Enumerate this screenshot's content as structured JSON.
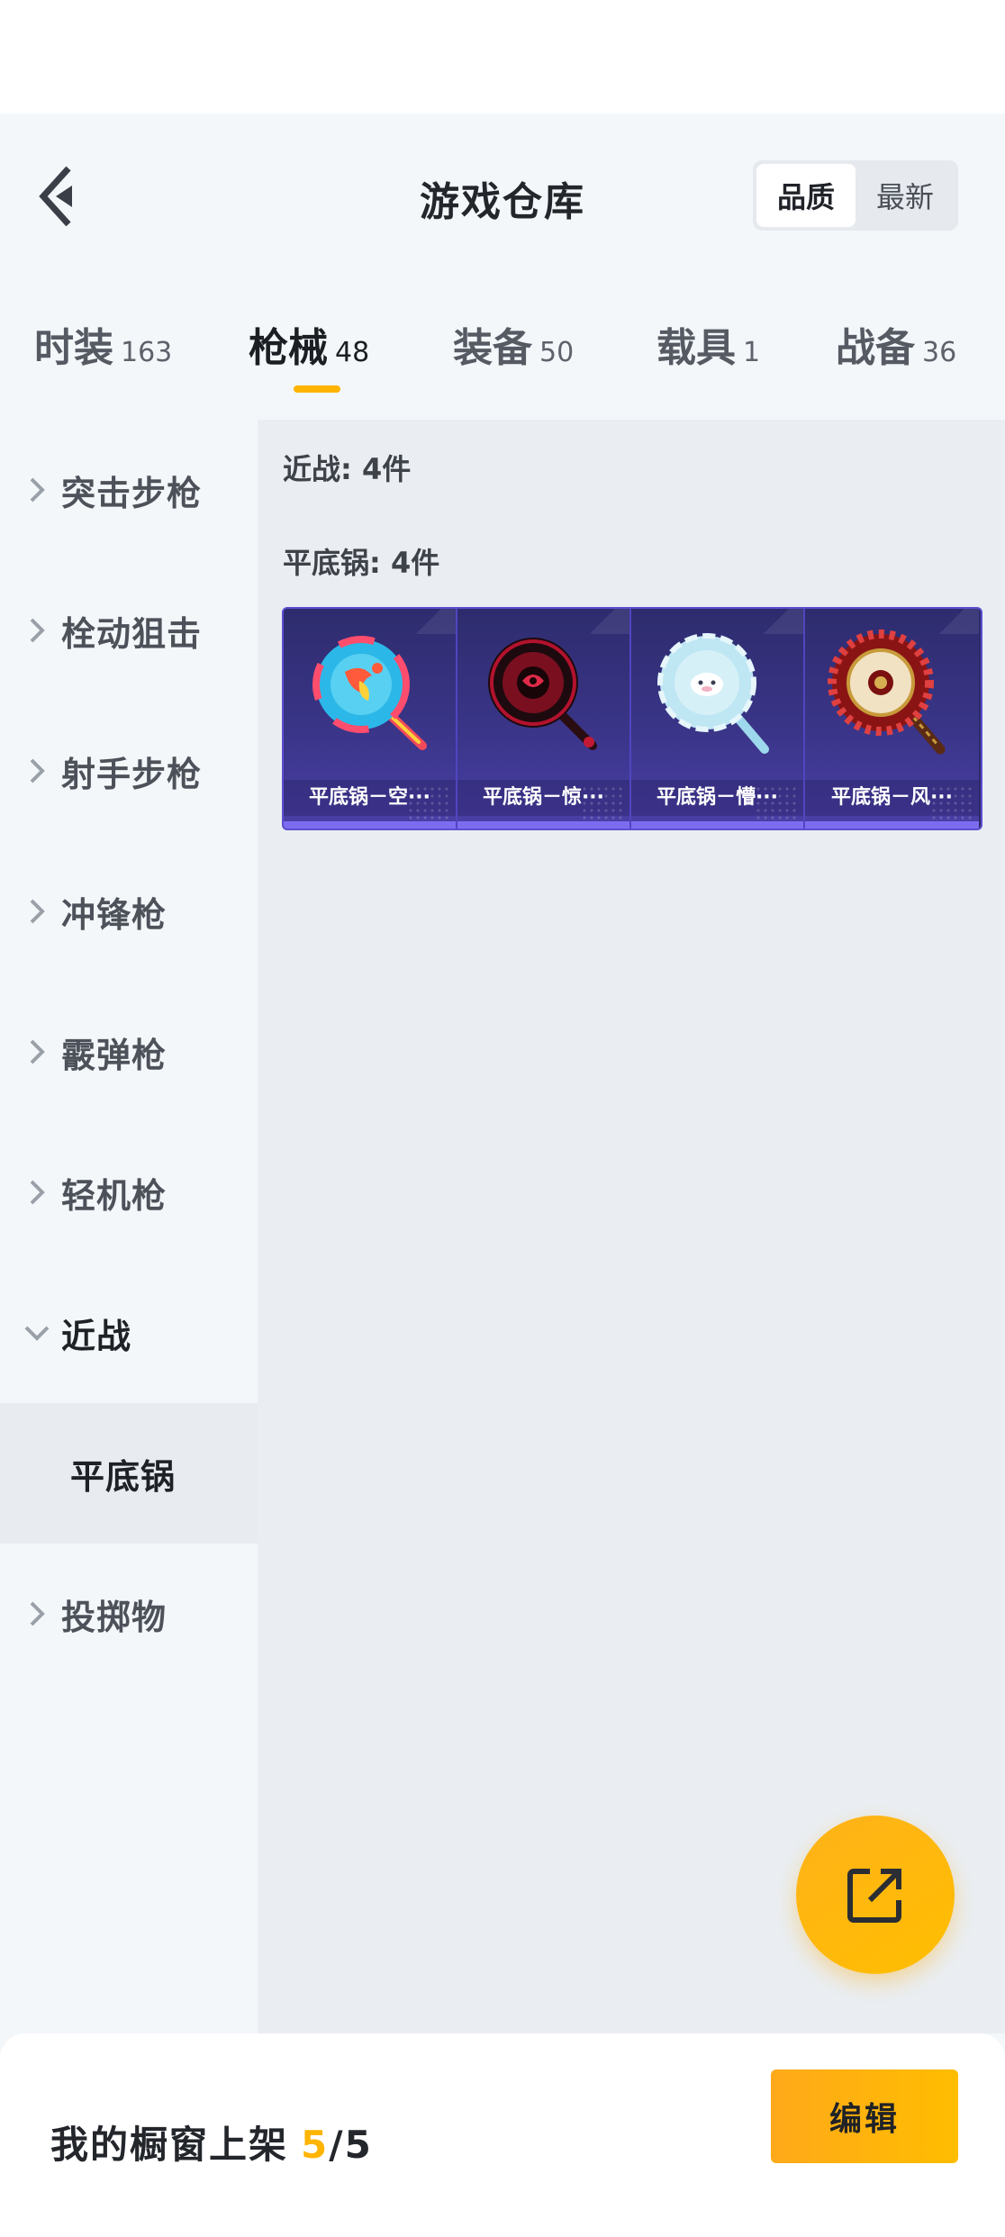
{
  "header": {
    "title": "游戏仓库",
    "sort_options": [
      "品质",
      "最新"
    ],
    "sort_selected": "品质"
  },
  "tabs": [
    {
      "label": "时装",
      "count": "163"
    },
    {
      "label": "枪械",
      "count": "48"
    },
    {
      "label": "装备",
      "count": "50"
    },
    {
      "label": "载具",
      "count": "1"
    },
    {
      "label": "战备",
      "count": "36"
    }
  ],
  "active_tab": "枪械",
  "sidebar": {
    "items": [
      {
        "label": "突击步枪"
      },
      {
        "label": "栓动狙击"
      },
      {
        "label": "射手步枪"
      },
      {
        "label": "冲锋枪"
      },
      {
        "label": "霰弹枪"
      },
      {
        "label": "轻机枪"
      },
      {
        "label": "近战"
      },
      {
        "label": "投掷物"
      }
    ],
    "expanded": "近战",
    "subitem": {
      "label": "平底锅"
    }
  },
  "content": {
    "group_label": "近战: 4件",
    "subgroup_label": "平底锅: 4件",
    "items": [
      {
        "name": "平底锅－空···",
        "icon": "colorful-pan-icon"
      },
      {
        "name": "平底锅－惊···",
        "icon": "dark-red-pan-icon"
      },
      {
        "name": "平底锅－懵···",
        "icon": "light-blue-pan-icon"
      },
      {
        "name": "平底锅－风···",
        "icon": "ornate-red-pan-icon"
      }
    ]
  },
  "fab": {
    "icon": "share-external-icon"
  },
  "bottom": {
    "showcase_label": "我的橱窗上架",
    "showcase_count": "5",
    "showcase_total": "/5",
    "edit_label": "编辑"
  },
  "colors": {
    "accent": "#ffb400",
    "item_card": "#3a3588",
    "background": "#f4f7fa"
  }
}
